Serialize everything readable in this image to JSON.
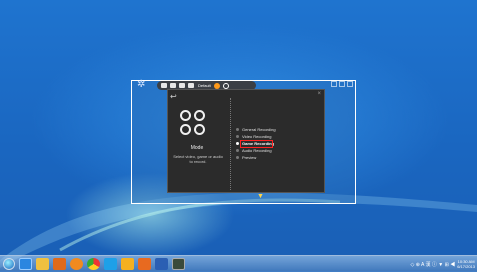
{
  "window": {
    "title": ""
  },
  "toolbar": {
    "label": "Default",
    "icons": [
      "monitor-icon",
      "camera-icon",
      "video-icon",
      "music-icon"
    ]
  },
  "dialog": {
    "back_icon": "↩",
    "close_icon": "×",
    "mode_title": "Mode",
    "mode_description": "Select video, game or audio to record.",
    "options": [
      {
        "label": "General Recording",
        "selected": false
      },
      {
        "label": "Video Recording",
        "selected": false
      },
      {
        "label": "Game Recording",
        "selected": true
      },
      {
        "label": "Audio Recording",
        "selected": false
      },
      {
        "label": "Preview",
        "selected": false
      }
    ]
  },
  "taskbar": {
    "apps": [
      "ie-icon",
      "folder-icon",
      "media-player-icon",
      "firefox-icon",
      "chrome-icon",
      "skype-icon",
      "app-icon",
      "firefox-icon-2",
      "word-icon",
      "recorder-icon"
    ],
    "tray_text": "◇ ⊕ A 漢 ⓘ ▼ ⊞ ◀",
    "time": "10:30 AM",
    "date": "6/17/2013"
  },
  "colors": {
    "highlight": "#ff2222",
    "accent": "#ff9a1a",
    "desktop": "#1f74cf"
  }
}
